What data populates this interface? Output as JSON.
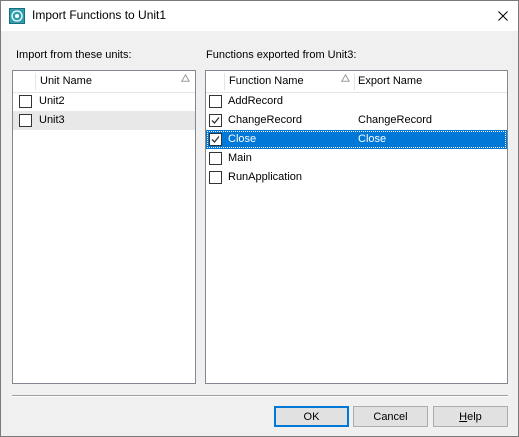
{
  "window": {
    "title": "Import Functions to Unit1"
  },
  "units_panel": {
    "label": "Import from these units:",
    "column_header": "Unit Name",
    "rows": [
      {
        "name": "Unit2",
        "checked": false
      },
      {
        "name": "Unit3",
        "checked": false
      }
    ]
  },
  "functions_panel": {
    "label": "Functions exported from Unit3:",
    "columns": [
      "Function Name",
      "Export Name"
    ],
    "rows": [
      {
        "function": "AddRecord",
        "export": "",
        "checked": false
      },
      {
        "function": "ChangeRecord",
        "export": "ChangeRecord",
        "checked": true
      },
      {
        "function": "Close",
        "export": "Close",
        "checked": true
      },
      {
        "function": "Main",
        "export": "",
        "checked": false
      },
      {
        "function": "RunApplication",
        "export": "",
        "checked": false
      }
    ]
  },
  "buttons": {
    "ok": "OK",
    "cancel": "Cancel",
    "help_prefix": "H",
    "help_rest": "elp"
  },
  "colors": {
    "selection": "#0078d7",
    "default_button_border": "#0078d7",
    "row_hover": "#e8e8e8"
  }
}
